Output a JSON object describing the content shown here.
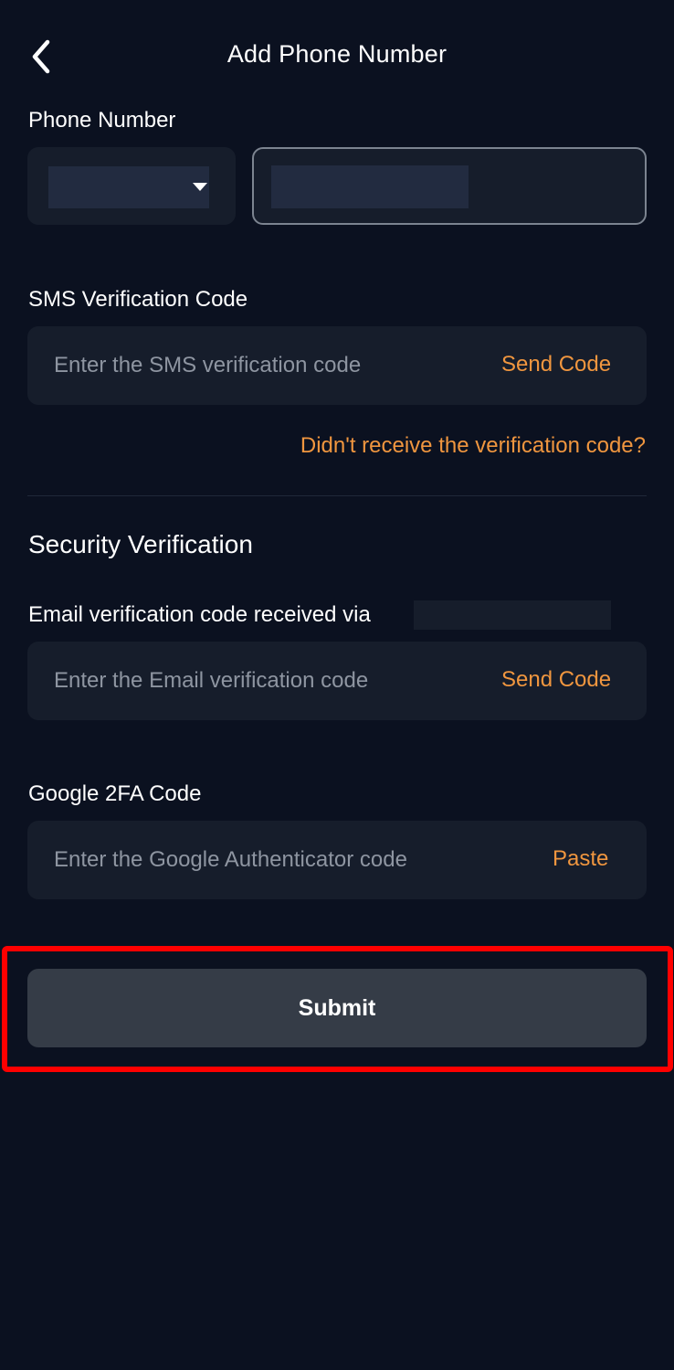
{
  "header": {
    "title": "Add Phone Number",
    "back_icon": "chevron-left-icon"
  },
  "phone": {
    "label": "Phone Number",
    "country_code_value": "",
    "number_value": ""
  },
  "sms": {
    "label": "SMS Verification Code",
    "placeholder": "Enter the SMS verification code",
    "send_label": "Send Code",
    "help_link": "Didn't receive the verification code?"
  },
  "security": {
    "title": "Security Verification",
    "email_label": "Email verification code received via",
    "email_placeholder": "Enter the Email verification code",
    "email_send_label": "Send Code",
    "google_label": "Google 2FA Code",
    "google_placeholder": "Enter the Google Authenticator code",
    "paste_label": "Paste"
  },
  "submit": {
    "label": "Submit"
  },
  "colors": {
    "background": "#0b1120",
    "field": "#161d2b",
    "accent": "#f0963f",
    "button": "#353c47",
    "highlight": "#ff0000"
  }
}
